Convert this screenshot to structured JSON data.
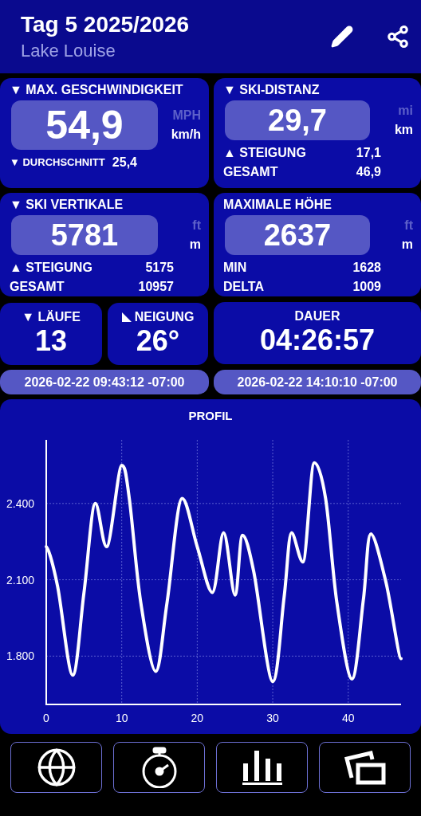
{
  "header": {
    "title": "Tag 5 2025/2026",
    "subtitle": "Lake Louise"
  },
  "cards": [
    {
      "title": "▼ MAX. GESCHWINDIGKEIT",
      "value": "54,9",
      "units": [
        {
          "label": "MPH",
          "selected": false
        },
        {
          "label": "km/h",
          "selected": true
        }
      ],
      "rows": [
        {
          "kind": "small",
          "label": "▼ DURCHSCHNITT",
          "value": "25,4"
        }
      ]
    },
    {
      "title": "▼ SKI-DISTANZ",
      "value": "29,7",
      "units": [
        {
          "label": "mi",
          "selected": false
        },
        {
          "label": "km",
          "selected": true
        }
      ],
      "rows": [
        {
          "kind": "normal",
          "label": "▲ STEIGUNG",
          "value": "17,1"
        },
        {
          "kind": "normal",
          "label": "GESAMT",
          "value": "46,9"
        }
      ]
    },
    {
      "title": "▼ SKI VERTIKALE",
      "value": "5781",
      "units": [
        {
          "label": "ft",
          "selected": false
        },
        {
          "label": "m",
          "selected": true
        }
      ],
      "rows": [
        {
          "kind": "normal",
          "label": "▲ STEIGUNG",
          "value": "5175"
        },
        {
          "kind": "normal",
          "label": "GESAMT",
          "value": "10957"
        }
      ]
    },
    {
      "title": "MAXIMALE HÖHE",
      "value": "2637",
      "units": [
        {
          "label": "ft",
          "selected": false
        },
        {
          "label": "m",
          "selected": true
        }
      ],
      "rows": [
        {
          "kind": "normal",
          "label": "MIN",
          "value": "1628"
        },
        {
          "kind": "normal",
          "label": "DELTA",
          "value": "1009"
        }
      ]
    }
  ],
  "tiles": [
    {
      "kind": "text",
      "label": "▼ LÄUFE",
      "value": "13"
    },
    {
      "kind": "slope",
      "label": "NEIGUNG",
      "value": "26°"
    },
    {
      "kind": "text",
      "label": "DAUER",
      "value": "04:26:57"
    }
  ],
  "times": [
    "2026-02-22 09:43:12 -07:00",
    "2026-02-22 14:10:10 -07:00"
  ],
  "profile": {
    "title": "PROFIL",
    "chart_data": {
      "type": "line",
      "x": [
        0,
        1.5,
        3.5,
        5,
        6.5,
        8,
        10,
        11,
        12.5,
        14.5,
        16,
        18,
        20,
        22,
        23.5,
        25,
        26,
        27.5,
        30,
        31.5,
        32.5,
        34,
        35.5,
        37,
        38.5,
        40.5,
        42,
        43,
        45,
        47
      ],
      "series": [
        {
          "color": "#ffffff",
          "values": [
            2230,
            2075,
            1725,
            2050,
            2400,
            2230,
            2550,
            2420,
            2015,
            1740,
            2010,
            2420,
            2230,
            2050,
            2285,
            2040,
            2275,
            2130,
            1700,
            2030,
            2285,
            2170,
            2560,
            2420,
            2010,
            1710,
            2020,
            2280,
            2090,
            1790
          ]
        }
      ],
      "grid": true,
      "xlim": [
        0,
        47
      ],
      "ylim": [
        1610,
        2650
      ],
      "xticks": [
        0,
        10,
        20,
        30,
        40
      ],
      "yticks": [
        {
          "value": 1800,
          "label": "1.800"
        },
        {
          "value": 2100,
          "label": "2.100"
        },
        {
          "value": 2400,
          "label": "2.400"
        }
      ]
    }
  },
  "nav": [
    {
      "kind": "globe"
    },
    {
      "kind": "stopwatch"
    },
    {
      "kind": "bars"
    },
    {
      "kind": "photos"
    }
  ]
}
